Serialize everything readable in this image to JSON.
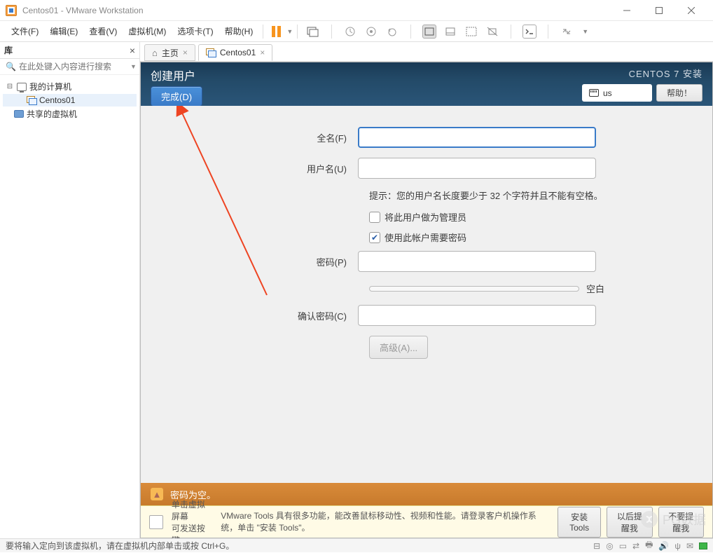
{
  "titlebar": {
    "title": "Centos01 - VMware Workstation"
  },
  "menu": {
    "file": "文件(F)",
    "edit": "编辑(E)",
    "view": "查看(V)",
    "vm": "虚拟机(M)",
    "tabs": "选项卡(T)",
    "help": "帮助(H)"
  },
  "sidebar": {
    "title": "库",
    "search_placeholder": "在此处键入内容进行搜索",
    "root": "我的计算机",
    "vm1": "Centos01",
    "shared": "共享的虚拟机"
  },
  "tabs": {
    "home": "主页",
    "vm": "Centos01"
  },
  "installer": {
    "header_title": "创建用户",
    "done": "完成(D)",
    "install_title": "CENTOS 7 安装",
    "kb": "us",
    "help": "帮助！",
    "fullname_label": "全名(F)",
    "username_label": "用户名(U)",
    "hint": "提示：您的用户名长度要少于 32 个字符并且不能有空格。",
    "chk_admin": "将此用户做为管理员",
    "chk_reqpass": "使用此帐户需要密码",
    "password_label": "密码(P)",
    "strength_label": "空白",
    "confirm_label": "确认密码(C)",
    "advanced": "高级(A)...",
    "warn": "密码为空。"
  },
  "tools": {
    "line1": "单击虚拟屏幕",
    "line2": "可发送按键",
    "msg": "VMware Tools 具有很多功能，能改善鼠标移动性、视频和性能。请登录客户机操作系统，单击 \"安装 Tools\"。",
    "btn_install": "安装 Tools",
    "btn_later": "以后提醒我",
    "btn_never": "不要提醒我"
  },
  "statusbar": {
    "text": "要将输入定向到该虚拟机，请在虚拟机内部单击或按 Ctrl+G。"
  },
  "watermark": "PG数据"
}
